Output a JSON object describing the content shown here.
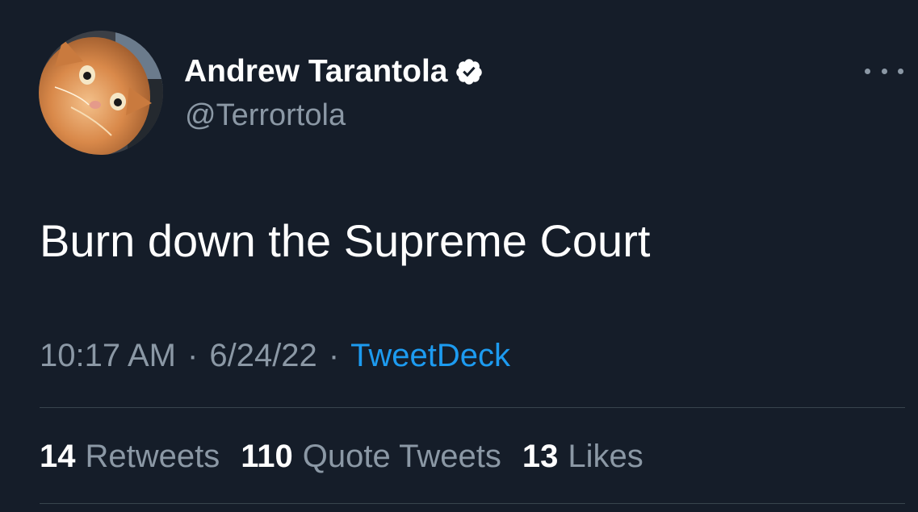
{
  "tweet": {
    "author": {
      "name": "Andrew Tarantola",
      "handle": "@Terrortola",
      "verified": true,
      "avatar_icon": "orange-cat-avatar"
    },
    "more_icon": "more-horizontal-icon",
    "text": "Burn down the Supreme Court",
    "time": "10:17 AM",
    "date": "6/24/22",
    "separator": "·",
    "source": "TweetDeck",
    "stats": {
      "retweets_count": "14",
      "retweets_label": "Retweets",
      "quotes_count": "110",
      "quotes_label": "Quote Tweets",
      "likes_count": "13",
      "likes_label": "Likes"
    },
    "colors": {
      "background": "#151d29",
      "text": "#ffffff",
      "secondary": "#8b98a5",
      "link": "#1d9bf0",
      "divider": "#38444d"
    }
  }
}
